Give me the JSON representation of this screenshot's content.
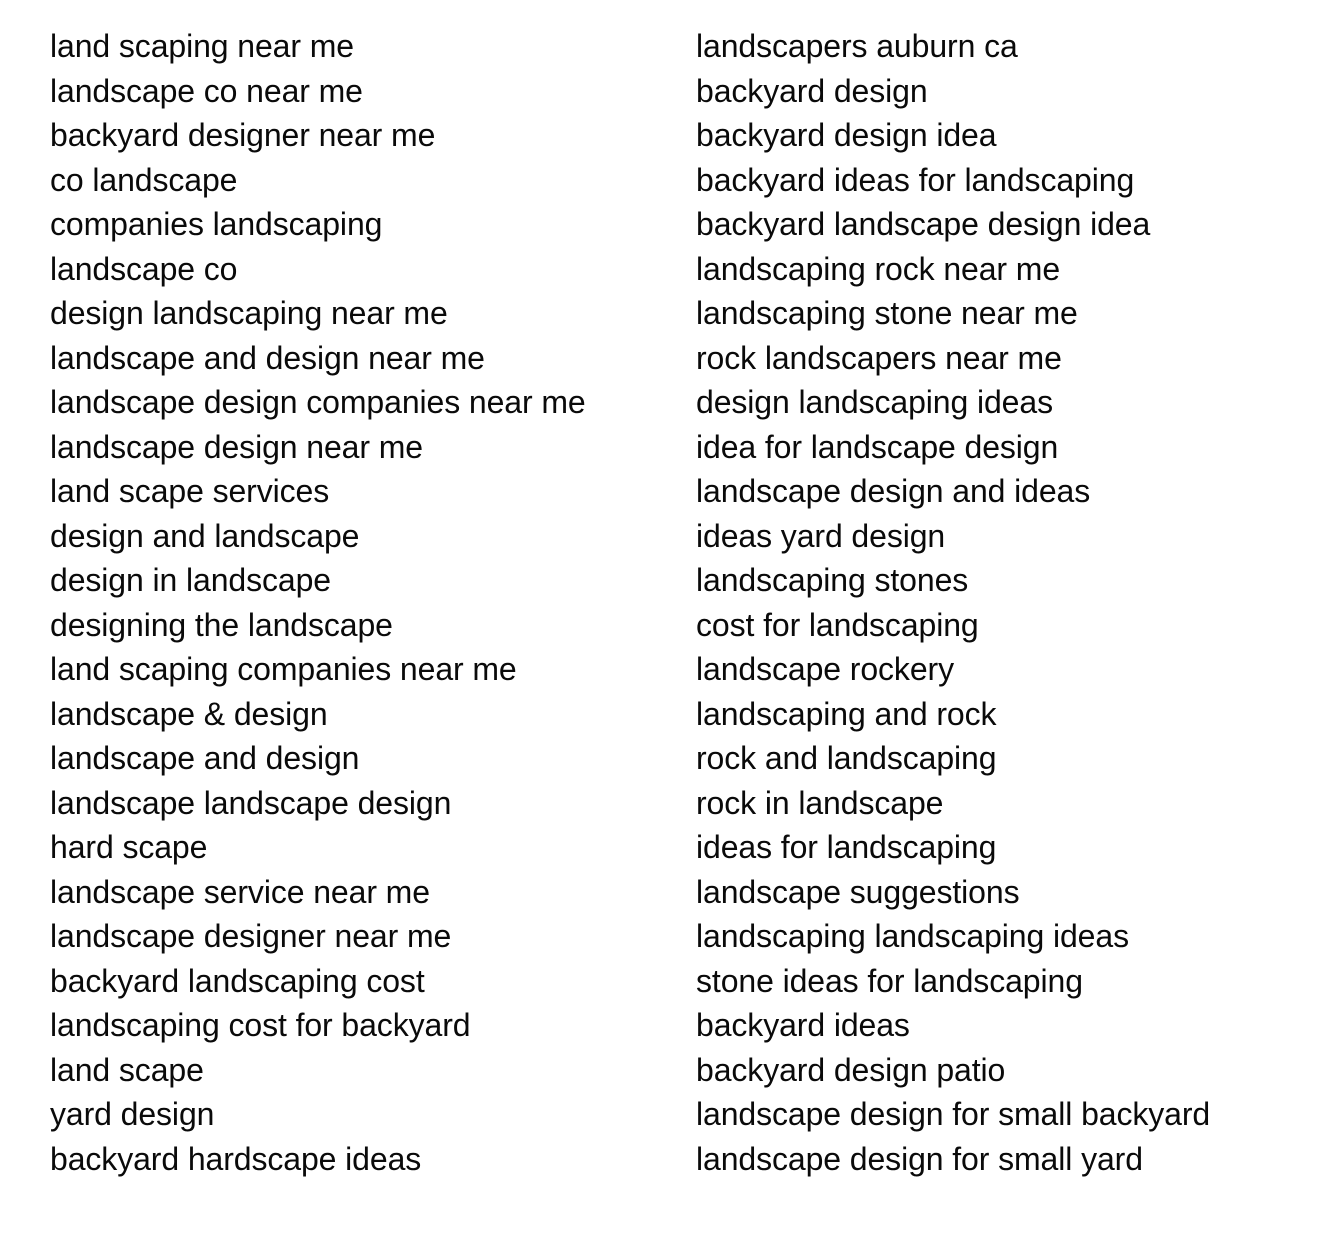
{
  "page": {
    "background_color": "#ffffff",
    "text_color": "#0a0a0a",
    "layout": "two-column keyword list"
  },
  "columns": {
    "left": {
      "items": [
        "land scaping near me",
        "landscape co near me",
        "backyard designer near me",
        "co landscape",
        "companies landscaping",
        "landscape co",
        "design landscaping near me",
        "landscape and design near me",
        "landscape design companies near me",
        "landscape design near me",
        "land scape services",
        "design and landscape",
        "design in landscape",
        "designing the landscape",
        "land scaping companies near me",
        "landscape & design",
        "landscape and design",
        "landscape landscape design",
        "hard scape",
        "landscape service near me",
        "landscape designer near me",
        "backyard landscaping cost",
        "landscaping cost for backyard",
        "land scape",
        "yard design",
        "backyard hardscape ideas"
      ]
    },
    "right": {
      "items": [
        "landscapers auburn ca",
        "backyard design",
        "backyard design idea",
        "backyard ideas for landscaping",
        "backyard landscape design idea",
        "landscaping rock near me",
        "landscaping stone near me",
        "rock landscapers near me",
        "design landscaping ideas",
        "idea for landscape design",
        "landscape design and ideas",
        "ideas yard design",
        "landscaping stones",
        "cost for landscaping",
        "landscape rockery",
        "landscaping and rock",
        "rock and landscaping",
        "rock in landscape",
        "ideas for landscaping",
        "landscape suggestions",
        "landscaping landscaping ideas",
        "stone ideas for landscaping",
        "backyard ideas",
        "backyard design patio",
        "landscape design for small backyard",
        "landscape design for small yard"
      ]
    }
  }
}
